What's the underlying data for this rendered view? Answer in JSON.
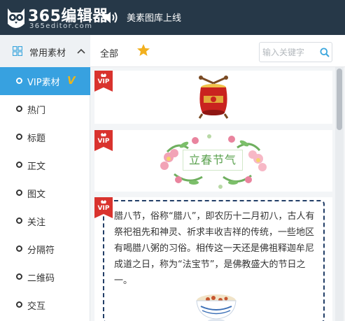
{
  "app": {
    "brand": "365编辑器",
    "domain": "365editor.com",
    "tagline": "美素图库上线"
  },
  "sidebar": {
    "header_label": "常用素材",
    "items": [
      {
        "label": "VIP素材",
        "active": true,
        "badge": "V"
      },
      {
        "label": "热门"
      },
      {
        "label": "标题"
      },
      {
        "label": "正文"
      },
      {
        "label": "图文"
      },
      {
        "label": "关注"
      },
      {
        "label": "分隔符"
      },
      {
        "label": "二维码"
      },
      {
        "label": "交互"
      }
    ]
  },
  "tabs": {
    "all_label": "全部",
    "favorites_icon": "star-icon"
  },
  "search": {
    "placeholder": "输入关键字",
    "value": ""
  },
  "cards": {
    "vip_badge": "VIP",
    "spring_title": "立春节气",
    "laba_text": "腊八节，俗称“腊八”，即农历十二月初八，古人有祭祀祖先和神灵、祈求丰收吉祥的传统，一些地区有喝腊八粥的习俗。相传这一天还是佛祖释迦牟尼成道之日，称为“法宝节”，是佛教盛大的节日之一。"
  },
  "colors": {
    "topbar": "#263848",
    "accent": "#37a1e0",
    "vip_red": "#d9332e",
    "star": "#f2b01e",
    "dashed_border": "#213d66"
  }
}
